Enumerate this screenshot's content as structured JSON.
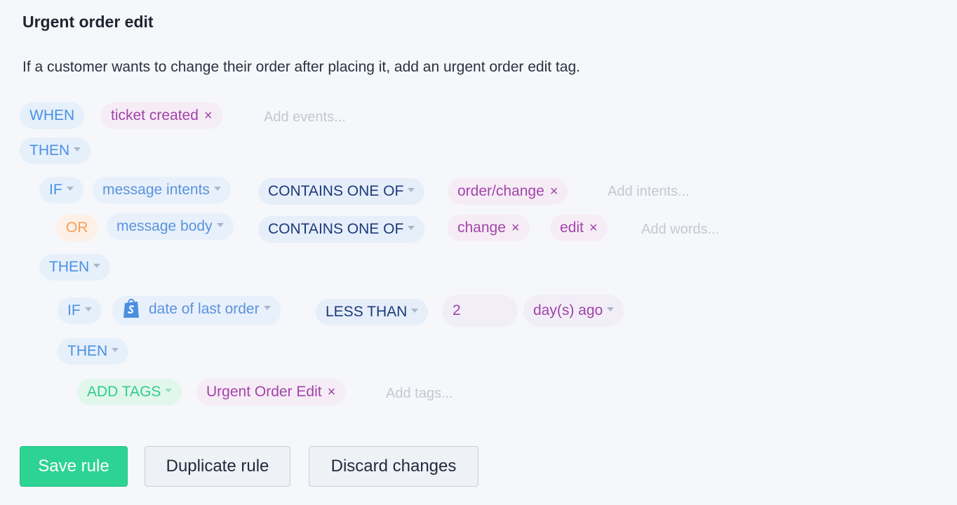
{
  "rule": {
    "title": "Urgent order edit",
    "description": "If a customer wants to change their order after placing it, add an urgent order edit tag."
  },
  "when_block": {
    "keyword": "WHEN",
    "event_tag": "ticket created",
    "events_placeholder": "Add events..."
  },
  "then_1": {
    "keyword": "THEN"
  },
  "if_1": {
    "keyword": "IF",
    "field": "message intents",
    "operator": "CONTAINS ONE OF",
    "value_tag": "order/change",
    "placeholder": "Add intents..."
  },
  "or_1": {
    "keyword": "OR",
    "field": "message body",
    "operator": "CONTAINS ONE OF",
    "value_tags": [
      "change",
      "edit"
    ],
    "placeholder": "Add words..."
  },
  "then_2": {
    "keyword": "THEN"
  },
  "if_2": {
    "keyword": "IF",
    "field": "date of last order",
    "operator": "LESS THAN",
    "value": "2",
    "unit": "day(s) ago"
  },
  "then_3": {
    "keyword": "THEN"
  },
  "action": {
    "keyword": "ADD TAGS",
    "tag": "Urgent Order Edit",
    "placeholder": "Add tags..."
  },
  "buttons": {
    "save": "Save rule",
    "duplicate": "Duplicate rule",
    "discard": "Discard changes"
  },
  "icons": {
    "remove": "×",
    "dropdown": "chevron-down-icon",
    "shopify": "shopify-bag-icon"
  },
  "colors": {
    "keyword_blue": "#4a90e2",
    "operator_navy": "#1c3a78",
    "tag_purple": "#a144a8",
    "or_orange": "#f5a05a",
    "action_green": "#2fcc8b",
    "save_button": "#2dd393"
  }
}
